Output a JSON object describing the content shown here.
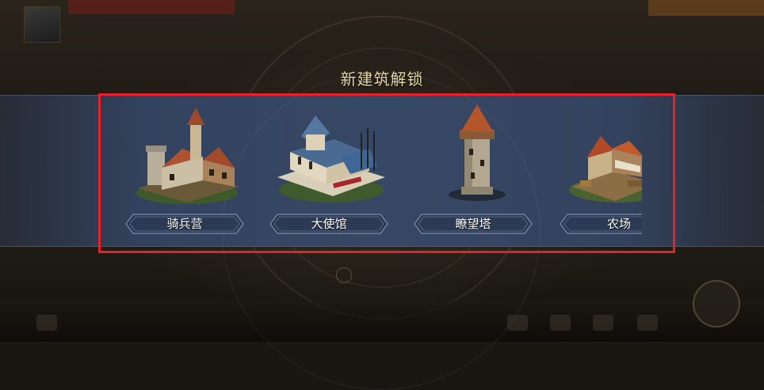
{
  "title": "新建筑解锁",
  "buildings": [
    {
      "name": "骑兵营",
      "icon": "cavalry-camp-icon"
    },
    {
      "name": "大使馆",
      "icon": "embassy-icon"
    },
    {
      "name": "瞭望塔",
      "icon": "watchtower-icon"
    },
    {
      "name": "农场",
      "icon": "farm-icon"
    }
  ],
  "colors": {
    "title": "#e6d7a6",
    "banner": "#374866",
    "highlight": "#e8202a",
    "plate": "#2c3a53"
  }
}
